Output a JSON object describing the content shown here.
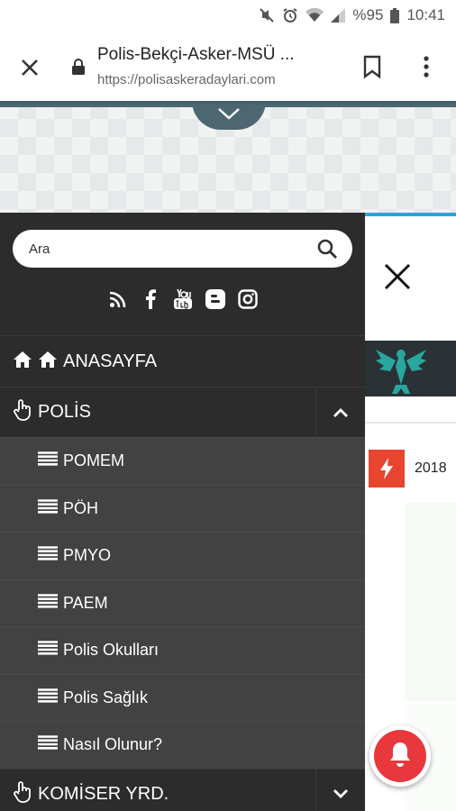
{
  "status": {
    "battery": "%95",
    "time": "10:41"
  },
  "browser": {
    "title": "Polis-Bekçi-Asker-MSÜ ...",
    "url": "https://polisaskeradaylari.com"
  },
  "search": {
    "placeholder": "Ara"
  },
  "social": [
    "rss-icon",
    "facebook-icon",
    "youtube-icon",
    "blogger-icon",
    "instagram-icon"
  ],
  "menu": {
    "home": "ANASAYFA",
    "polis": "POLİS",
    "komiser": "KOMİSER YRD.",
    "sub": [
      "POMEM",
      "PÖH",
      "PMYO",
      "PAEM",
      "Polis Okulları",
      "Polis Sağlık",
      "Nasıl Olunur?"
    ]
  },
  "right": {
    "news_year": "2018"
  },
  "colors": {
    "sidebar": "#2c2c2c",
    "submenu": "#424242",
    "accent": "#2fa3d9",
    "bell": "#e8383d"
  }
}
